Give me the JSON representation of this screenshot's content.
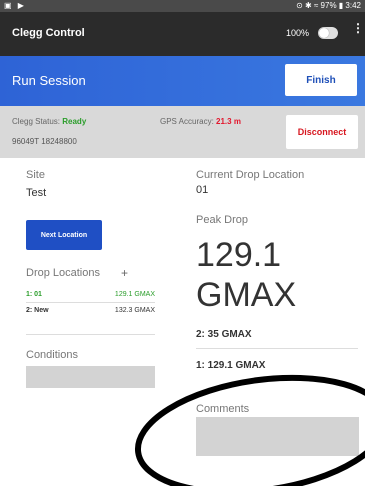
{
  "status_bar": {
    "left_icons": "▣ ▶",
    "right_text": "⊙ ✱ ≈ 97% ▮ 3:42"
  },
  "app_bar": {
    "title": "Clegg Control",
    "battery_percent": "100%",
    "menu_icon": "⋮"
  },
  "header": {
    "title": "Run Session",
    "finish_label": "Finish"
  },
  "status_row": {
    "clegg_status_label": "Clegg Status: ",
    "clegg_status_value": "Ready",
    "serial": "96049T 18248800",
    "gps_label": "GPS Accuracy: ",
    "gps_value": "21.3 m",
    "disconnect_label": "Disconnect"
  },
  "left_panel": {
    "site_label": "Site",
    "site_value": "Test",
    "next_location_label": "Next Location",
    "drop_locations_label": "Drop Locations",
    "add_label": "+",
    "drop_locations": [
      {
        "id": "1: 01",
        "value": "129.1 GMAX"
      },
      {
        "id": "2: New",
        "value": "132.3 GMAX"
      }
    ],
    "conditions_label": "Conditions"
  },
  "right_panel": {
    "current_drop_label": "Current Drop Location",
    "current_drop_value": "01",
    "peak_drop_label": "Peak Drop",
    "peak_value": "129.1",
    "peak_unit": "GMAX",
    "drops": [
      "2: 35 GMAX",
      "1: 129.1 GMAX"
    ],
    "comments_label": "Comments"
  },
  "colors": {
    "accent_blue": "#2e63d6",
    "ready_green": "#2a9d2a",
    "gps_red": "#e2162c"
  }
}
